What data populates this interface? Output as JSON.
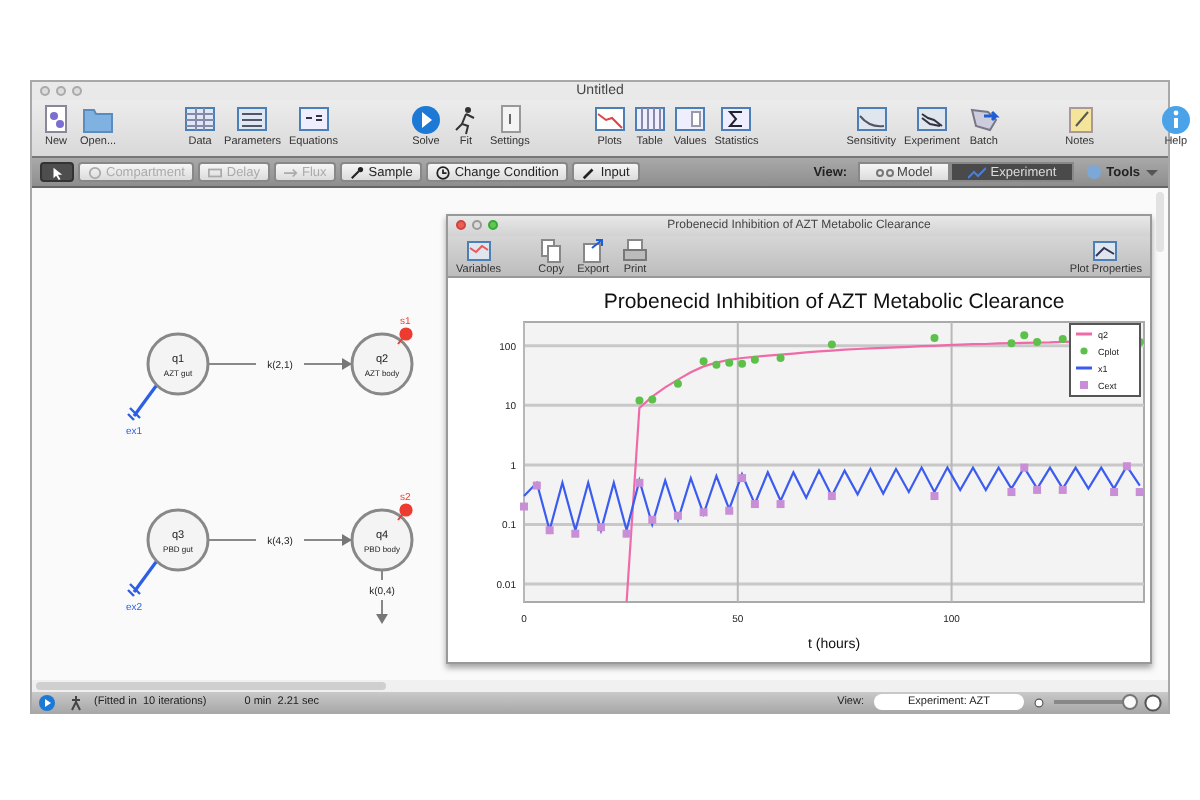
{
  "window": {
    "title": "Untitled"
  },
  "toolbar": {
    "groups": [
      [
        {
          "label": "New"
        },
        {
          "label": "Open..."
        }
      ],
      [
        {
          "label": "Data"
        },
        {
          "label": "Parameters"
        },
        {
          "label": "Equations"
        }
      ],
      [
        {
          "label": "Solve"
        },
        {
          "label": "Fit"
        },
        {
          "label": "Settings"
        }
      ],
      [
        {
          "label": "Plots"
        },
        {
          "label": "Table"
        },
        {
          "label": "Values"
        },
        {
          "label": "Statistics"
        }
      ],
      [
        {
          "label": "Sensitivity"
        },
        {
          "label": "Experiment"
        },
        {
          "label": "Batch"
        }
      ],
      [
        {
          "label": "Notes"
        }
      ],
      [
        {
          "label": "Help"
        }
      ]
    ]
  },
  "mode_bar": {
    "tools": [
      {
        "kind": "pointer",
        "selected": true,
        "disabled": false
      },
      {
        "kind": "compartment",
        "label": "Compartment",
        "selected": false,
        "disabled": true
      },
      {
        "kind": "delay",
        "label": "Delay",
        "selected": false,
        "disabled": true
      },
      {
        "kind": "flux",
        "label": "Flux",
        "selected": false,
        "disabled": true
      },
      {
        "kind": "sample",
        "label": "Sample",
        "selected": false,
        "disabled": false
      },
      {
        "kind": "condition",
        "label": "Change Condition",
        "selected": false,
        "disabled": false
      },
      {
        "kind": "input",
        "label": "Input",
        "selected": false,
        "disabled": false
      }
    ],
    "view_label": "View:",
    "views": [
      {
        "label": "Model",
        "selected": false
      },
      {
        "label": "Experiment",
        "selected": true
      }
    ],
    "tools_menu": "Tools"
  },
  "model": {
    "compartments": [
      {
        "name": "q1",
        "label": "AZT gut"
      },
      {
        "name": "q2",
        "label": "AZT body"
      },
      {
        "name": "q3",
        "label": "PBD gut"
      },
      {
        "name": "q4",
        "label": "PBD body"
      }
    ],
    "flows": [
      {
        "label": "k(2,1)"
      },
      {
        "label": "k(4,3)"
      },
      {
        "label": "k(0,4)"
      }
    ],
    "inputs": [
      {
        "label": "ex1"
      },
      {
        "label": "ex2"
      }
    ],
    "samples": [
      {
        "label": "s1"
      },
      {
        "label": "s2"
      }
    ]
  },
  "plot_window": {
    "title": "Probenecid Inhibition of AZT Metabolic Clearance",
    "toolbar": [
      {
        "label": "Variables"
      },
      {
        "label": "Copy"
      },
      {
        "label": "Export"
      },
      {
        "label": "Print"
      },
      {
        "label": "Plot Properties"
      }
    ],
    "plot": {
      "title": "Probenecid Inhibition of AZT Metabolic Clearance",
      "xlabel": "t (hours)",
      "x_tick_labels": [
        "0",
        "50",
        "100"
      ],
      "y_tick_labels": [
        "100",
        "10",
        "1",
        "0.1",
        "0.01"
      ],
      "legend": [
        {
          "name": "q2",
          "kind": "line",
          "color": "#f06aa8"
        },
        {
          "name": "Cplot",
          "kind": "dots",
          "color": "#5cc04a"
        },
        {
          "name": "x1",
          "kind": "line",
          "color": "#3b5cf0"
        },
        {
          "name": "Cext",
          "kind": "squares",
          "color": "#c98fd6"
        }
      ]
    }
  },
  "status_bar": {
    "message": "(Fitted in  10 iterations)",
    "time": "0 min  2.21 sec",
    "view_label": "View:",
    "view_value": "Experiment: AZT",
    "zoom": {
      "level": 0.95
    }
  }
}
